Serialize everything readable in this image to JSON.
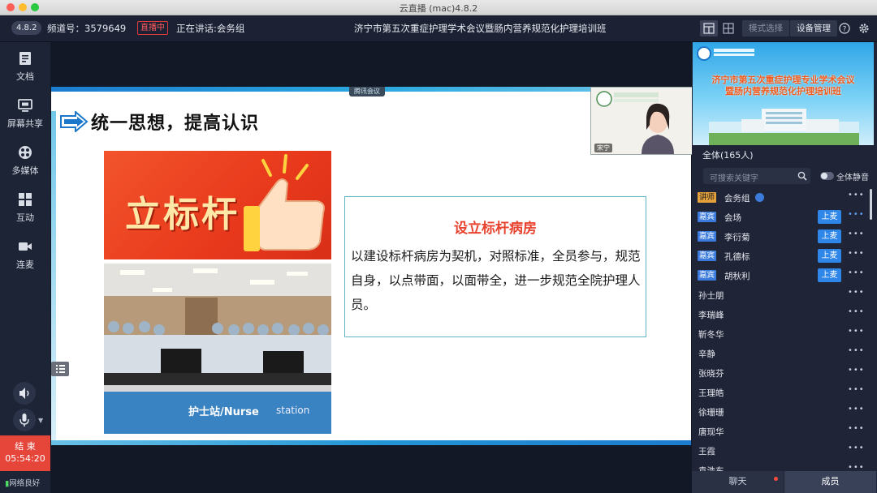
{
  "window": {
    "title": "云直播 (mac)4.8.2"
  },
  "header": {
    "version": "4.8.2",
    "channel": "频道号：3579649",
    "live_badge": "直播中",
    "speaking": "正在讲话:会务组",
    "meeting_title": "济宁市第五次重症护理学术会议暨肠内营养规范化护理培训班",
    "mode_select": "模式选择",
    "device_mgmt": "设备管理"
  },
  "toolbar": {
    "items": [
      {
        "label": "文档",
        "icon": "document-icon"
      },
      {
        "label": "屏幕共享",
        "icon": "screen-share-icon"
      },
      {
        "label": "多媒体",
        "icon": "media-icon"
      },
      {
        "label": "互动",
        "icon": "grid-icon"
      },
      {
        "label": "连麦",
        "icon": "camera-icon"
      }
    ],
    "end_label": "结 束",
    "end_time": "05:54:20",
    "network": "网络良好"
  },
  "slide": {
    "tencent_tag": "腾讯会议",
    "title": "统一思想，提高认识",
    "image1_text": "立标杆",
    "image2_label": "护士站/Nurse",
    "image2_label2": "station",
    "box_title": "设立标杆病房",
    "box_body": "以建设标杆病房为契机，对照标准，全员参与，规范自身，以点带面，以面带全，进一步规范全院护理人员。",
    "video_name": "宋宁"
  },
  "panel": {
    "banner_title_1": "济宁市第五次重症护理专业学术会议",
    "banner_title_2": "暨肠内营养规范化护理培训班",
    "all_count": "全体(165人)",
    "search_placeholder": "可搜索关键字",
    "mute_all": "全体静音",
    "members": [
      {
        "badge": "讲师",
        "type": "host",
        "name": "会务组",
        "up": ""
      },
      {
        "badge": "嘉宾",
        "type": "guest",
        "name": "会场",
        "up": "上麦"
      },
      {
        "badge": "嘉宾",
        "type": "guest",
        "name": "李衍菊",
        "up": "上麦"
      },
      {
        "badge": "嘉宾",
        "type": "guest",
        "name": "孔德标",
        "up": "上麦"
      },
      {
        "badge": "嘉宾",
        "type": "guest",
        "name": "胡秋利",
        "up": "上麦"
      },
      {
        "badge": "",
        "type": "",
        "name": "孙士朋",
        "up": ""
      },
      {
        "badge": "",
        "type": "",
        "name": "李瑞峰",
        "up": ""
      },
      {
        "badge": "",
        "type": "",
        "name": "靳冬华",
        "up": ""
      },
      {
        "badge": "",
        "type": "",
        "name": "辛静",
        "up": ""
      },
      {
        "badge": "",
        "type": "",
        "name": "张晓芬",
        "up": ""
      },
      {
        "badge": "",
        "type": "",
        "name": "王理皓",
        "up": ""
      },
      {
        "badge": "",
        "type": "",
        "name": "徐珊珊",
        "up": ""
      },
      {
        "badge": "",
        "type": "",
        "name": "唐现华",
        "up": ""
      },
      {
        "badge": "",
        "type": "",
        "name": "王霞",
        "up": ""
      },
      {
        "badge": "",
        "type": "",
        "name": "袁浩东",
        "up": ""
      }
    ],
    "more": "•••",
    "tab_chat": "聊天",
    "tab_members": "成员"
  },
  "colors": {
    "accent": "#2d86e8",
    "live": "#e23b3b",
    "end": "#e6453a",
    "slide_title_red": "#e8432f"
  }
}
